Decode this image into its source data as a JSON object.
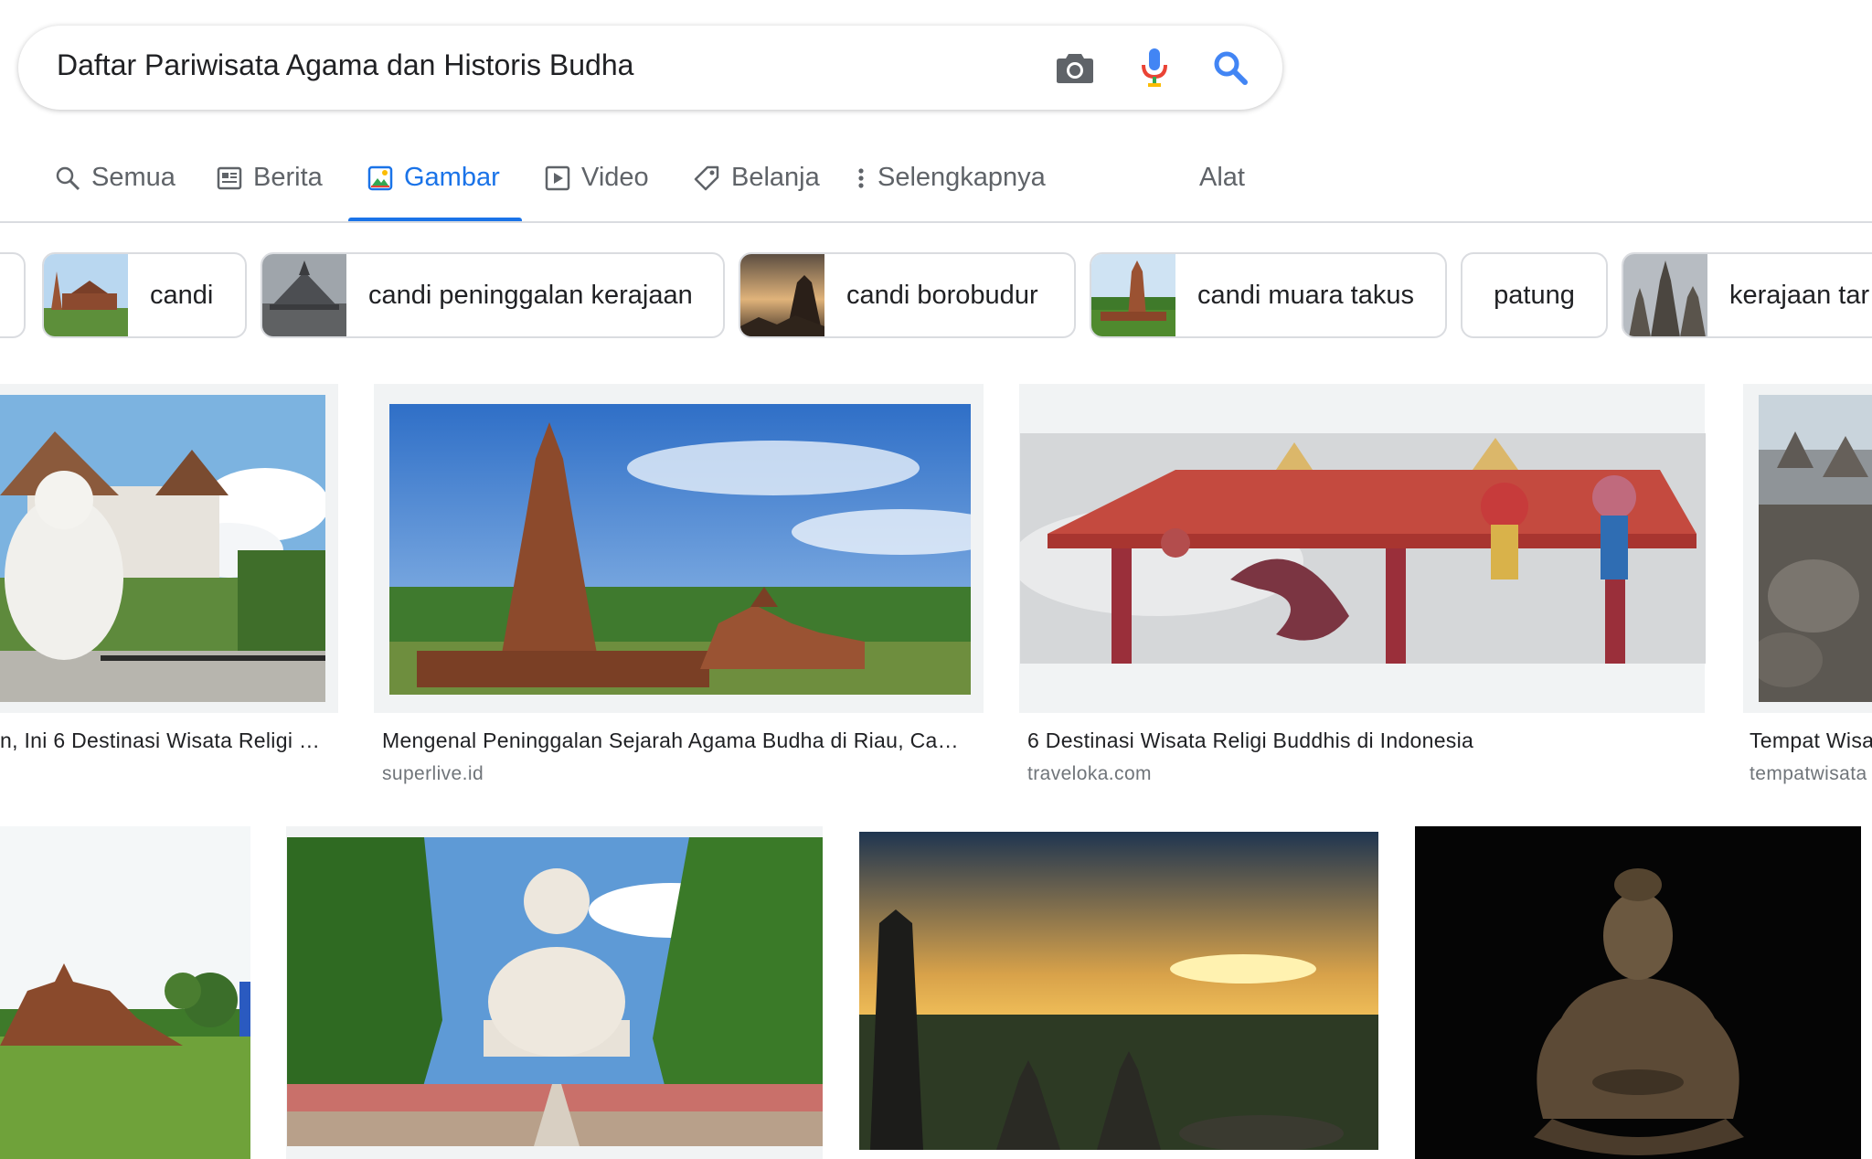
{
  "search": {
    "query": "Daftar Pariwisata Agama dan Historis Budha",
    "icons": [
      "camera-icon",
      "microphone-icon",
      "search-icon"
    ]
  },
  "tabs": [
    {
      "label": "Semua",
      "icon": "search-icon"
    },
    {
      "label": "Berita",
      "icon": "news-icon"
    },
    {
      "label": "Gambar",
      "icon": "image-icon",
      "active": true
    },
    {
      "label": "Video",
      "icon": "video-icon"
    },
    {
      "label": "Belanja",
      "icon": "tag-icon"
    },
    {
      "label": "Selengkapnya",
      "icon": "more-vert-icon"
    }
  ],
  "tools_label": "Alat",
  "chips": [
    {
      "label": "candi"
    },
    {
      "label": "candi peninggalan kerajaan"
    },
    {
      "label": "candi borobudur"
    },
    {
      "label": "candi muara takus"
    },
    {
      "label": "patung"
    },
    {
      "label": "kerajaan tar"
    }
  ],
  "results": [
    {
      "title": "n, Ini 6 Destinasi Wisata Religi …",
      "source": ""
    },
    {
      "title": "Mengenal Peninggalan Sejarah Agama Budha di Riau, Ca…",
      "source": "superlive.id"
    },
    {
      "title": "6 Destinasi Wisata Religi Buddhis di Indonesia",
      "source": "traveloka.com"
    },
    {
      "title": "Tempat Wisa",
      "source": "tempatwisata"
    }
  ],
  "colors": {
    "accent": "#1a73e8",
    "muted": "#5f6368",
    "border": "#dadce0"
  }
}
